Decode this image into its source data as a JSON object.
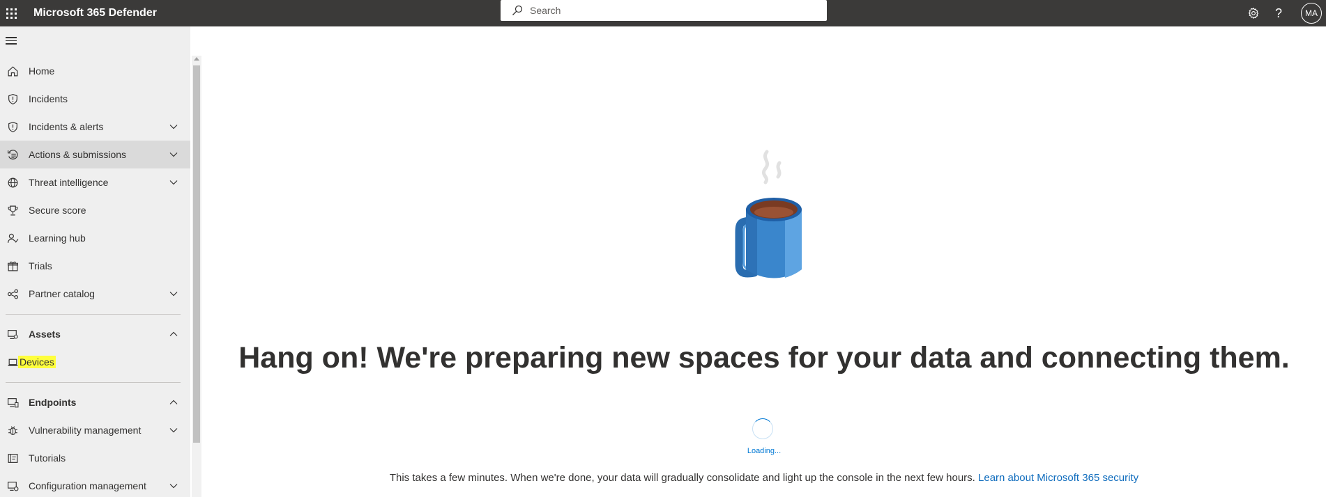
{
  "header": {
    "app_title": "Microsoft 365 Defender",
    "search_placeholder": "Search",
    "help_label": "?",
    "avatar_initials": "MA"
  },
  "sidebar": {
    "items": [
      {
        "label": "Home",
        "icon": "home-icon"
      },
      {
        "label": "Incidents",
        "icon": "shield-icon"
      },
      {
        "label": "Incidents & alerts",
        "icon": "shield-icon",
        "expandable": true
      },
      {
        "label": "Actions & submissions",
        "icon": "actions-history-icon",
        "expandable": true,
        "active": true
      },
      {
        "label": "Threat intelligence",
        "icon": "globe-threat-icon",
        "expandable": true
      },
      {
        "label": "Secure score",
        "icon": "trophy-icon"
      },
      {
        "label": "Learning hub",
        "icon": "learning-person-icon"
      },
      {
        "label": "Trials",
        "icon": "gift-icon"
      },
      {
        "label": "Partner catalog",
        "icon": "partner-network-icon",
        "expandable": true
      },
      {
        "label": "Assets",
        "icon": "assets-icon",
        "section": true,
        "expanded": true
      },
      {
        "label": "Devices",
        "icon": "laptop-icon",
        "highlighted": true
      },
      {
        "label": "Endpoints",
        "icon": "endpoints-icon",
        "section": true,
        "expanded": true
      },
      {
        "label": "Vulnerability management",
        "icon": "vulnerability-icon",
        "expandable": true
      },
      {
        "label": "Tutorials",
        "icon": "tutorials-icon"
      },
      {
        "label": "Configuration management",
        "icon": "configuration-icon",
        "expandable": true
      }
    ]
  },
  "main": {
    "heading": "Hang on! We're preparing new spaces for your data and connecting them.",
    "loading_text": "Loading...",
    "footer_text": "This takes a few minutes. When we're done, your data will gradually consolidate and light up the console in the next few hours.",
    "footer_link": "Learn about Microsoft 365 security"
  },
  "colors": {
    "topbar": "#3b3a39",
    "sidebar": "#efefef",
    "active_item": "#dadada",
    "highlight": "#ffff3c",
    "accent": "#0078d4",
    "link": "#0f6cbd",
    "mug_blue": "#3a86cc",
    "coffee": "#7a3b22"
  }
}
